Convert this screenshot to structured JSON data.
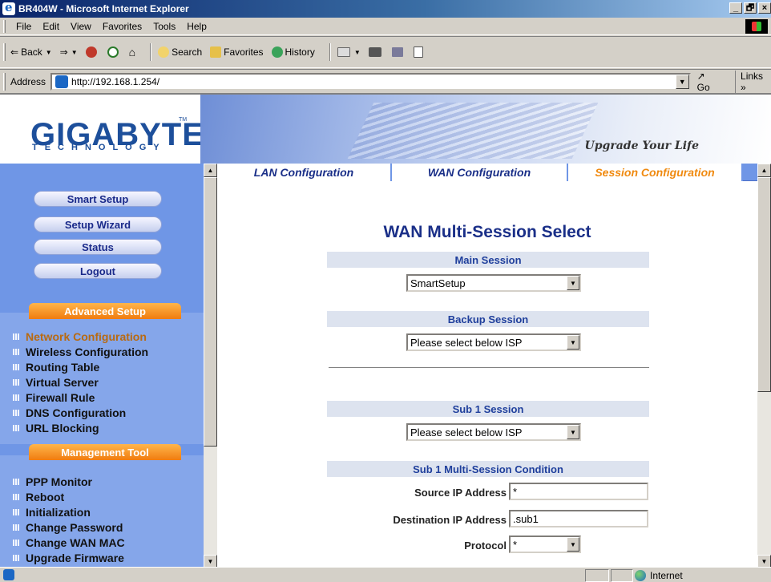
{
  "window": {
    "title": "BR404W - Microsoft Internet Explorer",
    "min": "_",
    "max": "🗗",
    "close": "×"
  },
  "menu": [
    "File",
    "Edit",
    "View",
    "Favorites",
    "Tools",
    "Help"
  ],
  "toolbar": {
    "back": "Back",
    "search": "Search",
    "favorites": "Favorites",
    "history": "History"
  },
  "address": {
    "label": "Address",
    "url": "http://192.168.1.254/",
    "go": "Go",
    "links": "Links"
  },
  "banner": {
    "logo": "GIGABYTE",
    "tm": "TM",
    "sub": "TECHNOLOGY",
    "slogan": "Upgrade Your Life"
  },
  "sidebar": {
    "buttons": [
      "Smart Setup",
      "Setup Wizard",
      "Status",
      "Logout"
    ],
    "advanced_header": "Advanced Setup",
    "advanced_items": [
      "Network Configuration",
      "Wireless Configuration",
      "Routing Table",
      "Virtual Server",
      "Firewall Rule",
      "DNS Configuration",
      "URL Blocking"
    ],
    "management_header": "Management Tool",
    "management_items": [
      "PPP Monitor",
      "Reboot",
      "Initialization",
      "Change Password",
      "Change WAN MAC",
      "Upgrade Firmware"
    ]
  },
  "tabs": [
    "LAN Configuration",
    "WAN Configuration",
    "Session Configuration"
  ],
  "content": {
    "title": "WAN Multi-Session Select",
    "main_session": {
      "label": "Main Session",
      "value": "SmartSetup"
    },
    "backup_session": {
      "label": "Backup Session",
      "value": "Please select below ISP"
    },
    "sub1_session": {
      "label": "Sub 1 Session",
      "value": "Please select below ISP"
    },
    "condition": {
      "header": "Sub 1 Multi-Session Condition",
      "source_label": "Source IP Address",
      "source_value": "*",
      "dest_label": "Destination IP Address",
      "dest_value": ".sub1",
      "protocol_label": "Protocol",
      "protocol_value": "*"
    }
  },
  "status": {
    "zone": "Internet"
  },
  "colors": {
    "sidebar": "#6f96e6",
    "accent": "#f08a10",
    "title": "#1a2f88"
  }
}
